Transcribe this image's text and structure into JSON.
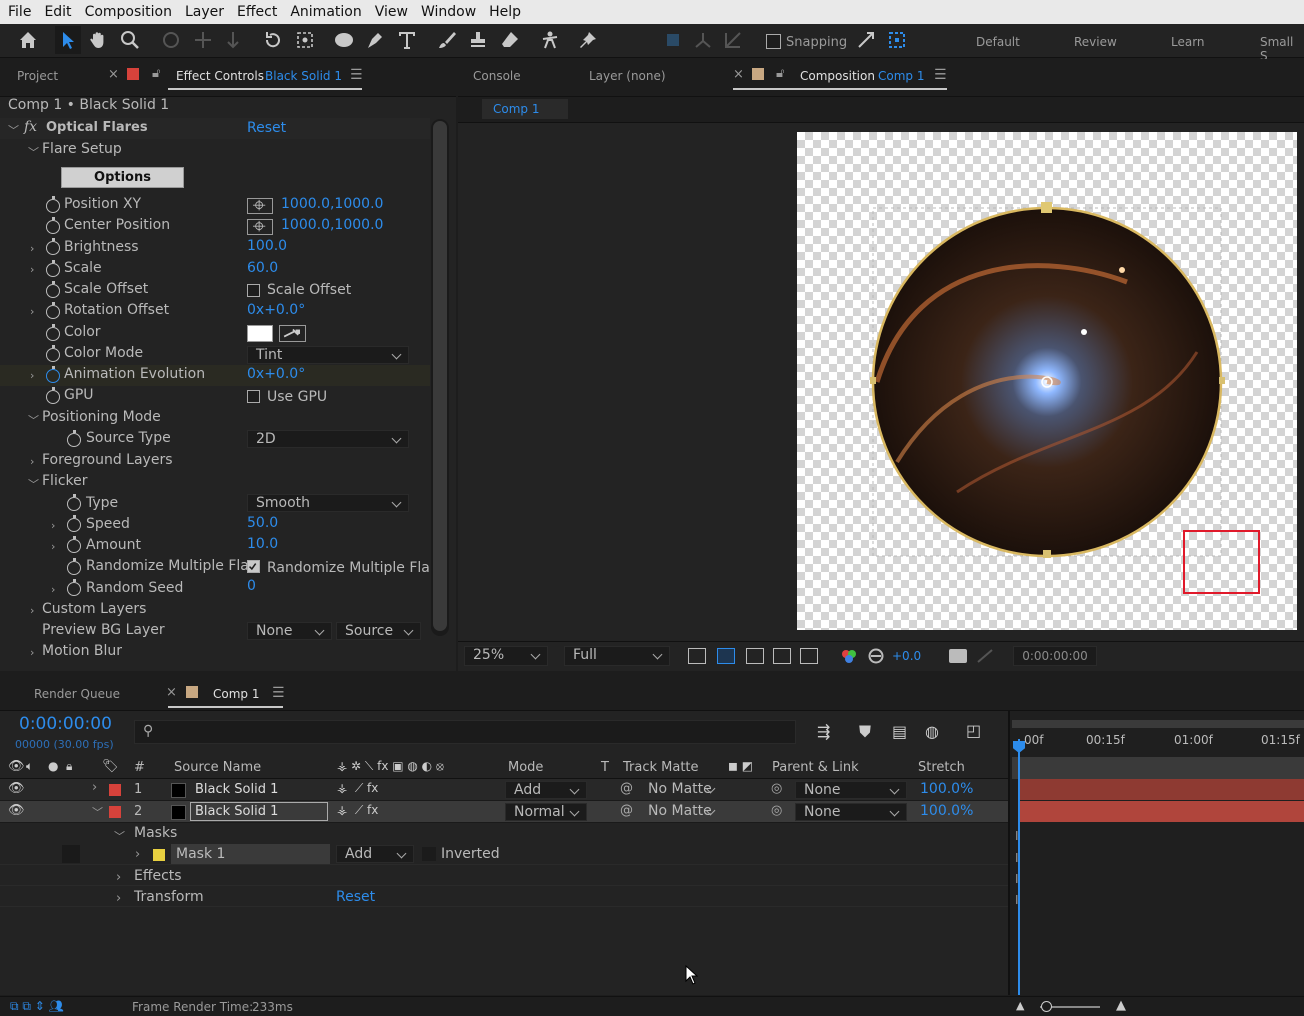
{
  "menu": [
    "File",
    "Edit",
    "Composition",
    "Layer",
    "Effect",
    "Animation",
    "View",
    "Window",
    "Help"
  ],
  "toolbar": {
    "snapping": "Snapping",
    "workspaces": [
      "Default",
      "Review",
      "Learn",
      "Small S"
    ]
  },
  "left_panel": {
    "tab_project": "Project",
    "tab_effect": "Effect Controls",
    "tab_effect_layer": "Black Solid 1",
    "breadcrumb": "Comp 1 • Black Solid 1",
    "effect_name": "Optical Flares",
    "reset": "Reset",
    "flare_setup": "Flare Setup",
    "options_btn": "Options",
    "props": {
      "position_xy": {
        "label": "Position XY",
        "value": "1000.0,1000.0"
      },
      "center_position": {
        "label": "Center Position",
        "value": "1000.0,1000.0"
      },
      "brightness": {
        "label": "Brightness",
        "value": "100.0"
      },
      "scale": {
        "label": "Scale",
        "value": "60.0"
      },
      "scale_offset": {
        "label": "Scale Offset",
        "value": "Scale Offset"
      },
      "rotation_offset": {
        "label": "Rotation Offset",
        "value": "0x+0.0°"
      },
      "color": {
        "label": "Color"
      },
      "color_mode": {
        "label": "Color Mode",
        "value": "Tint"
      },
      "animation_evolution": {
        "label": "Animation Evolution",
        "value": "0x+0.0°"
      },
      "gpu": {
        "label": "GPU",
        "value": "Use GPU"
      },
      "positioning_mode": {
        "label": "Positioning Mode"
      },
      "source_type": {
        "label": "Source Type",
        "value": "2D"
      },
      "foreground_layers": {
        "label": "Foreground Layers"
      },
      "flicker": {
        "label": "Flicker"
      },
      "type": {
        "label": "Type",
        "value": "Smooth"
      },
      "speed": {
        "label": "Speed",
        "value": "50.0"
      },
      "amount": {
        "label": "Amount",
        "value": "10.0"
      },
      "randomize": {
        "label": "Randomize Multiple Flar",
        "value": "Randomize Multiple Flar"
      },
      "random_seed": {
        "label": "Random Seed",
        "value": "0"
      },
      "custom_layers": {
        "label": "Custom Layers"
      },
      "preview_bg": {
        "label": "Preview BG Layer",
        "value": "None",
        "value2": "Source"
      },
      "motion_blur": {
        "label": "Motion Blur"
      }
    }
  },
  "right_panel": {
    "tab_console": "Console",
    "tab_layer": "Layer (none)",
    "tab_comp": "Composition",
    "tab_comp_name": "Comp 1",
    "sub_tab": "Comp 1",
    "zoom": "25%",
    "resolution": "Full",
    "exposure": "+0.0",
    "timecode": "0:00:00:00"
  },
  "timeline": {
    "tab_render": "Render Queue",
    "tab_comp": "Comp 1",
    "timecode": "0:00:00:00",
    "frames": "00000 (30.00 fps)",
    "cols": {
      "num": "#",
      "source": "Source Name",
      "mode": "Mode",
      "t": "T",
      "track": "Track Matte",
      "parent": "Parent & Link",
      "stretch": "Stretch"
    },
    "ruler": [
      "00f",
      "00:15f",
      "01:00f",
      "01:15f"
    ],
    "layers": [
      {
        "num": "1",
        "name": "Black Solid 1",
        "mode": "Add",
        "matte": "No Matte",
        "parent": "None",
        "stretch": "100.0%"
      },
      {
        "num": "2",
        "name": "Black Solid 1",
        "mode": "Normal",
        "matte": "No Matte",
        "parent": "None",
        "stretch": "100.0%"
      }
    ],
    "masks": "Masks",
    "mask1": "Mask 1",
    "mask_mode": "Add",
    "inverted": "Inverted",
    "effects": "Effects",
    "transform": "Transform",
    "reset": "Reset"
  },
  "status": {
    "label": "Frame Render Time: ",
    "value": "233ms"
  },
  "colors": {
    "accent": "#2d8ceb",
    "layer_red": "#c0392b",
    "highlight_box": "#e0192a"
  }
}
